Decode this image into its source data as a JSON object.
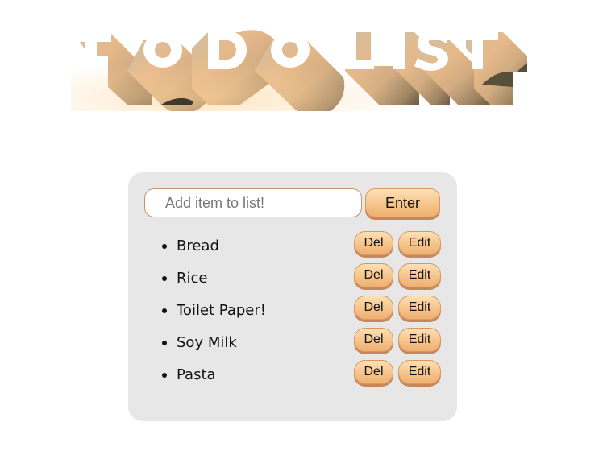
{
  "header": {
    "title": "TO DO LIST"
  },
  "input": {
    "placeholder": "Add item to list!",
    "value": ""
  },
  "enter_button": {
    "label": "Enter"
  },
  "items": [
    {
      "text": "Bread",
      "del_label": "Del",
      "edit_label": "Edit"
    },
    {
      "text": "Rice",
      "del_label": "Del",
      "edit_label": "Edit"
    },
    {
      "text": "Toilet Paper!",
      "del_label": "Del",
      "edit_label": "Edit"
    },
    {
      "text": "Soy Milk",
      "del_label": "Del",
      "edit_label": "Edit"
    },
    {
      "text": "Pasta",
      "del_label": "Del",
      "edit_label": "Edit"
    }
  ],
  "colors": {
    "button_top": "#fde0b6",
    "button_bottom": "#eeb070",
    "button_border": "#d8985e",
    "card_background": "#e7e7e7",
    "input_border": "#c9936a"
  }
}
